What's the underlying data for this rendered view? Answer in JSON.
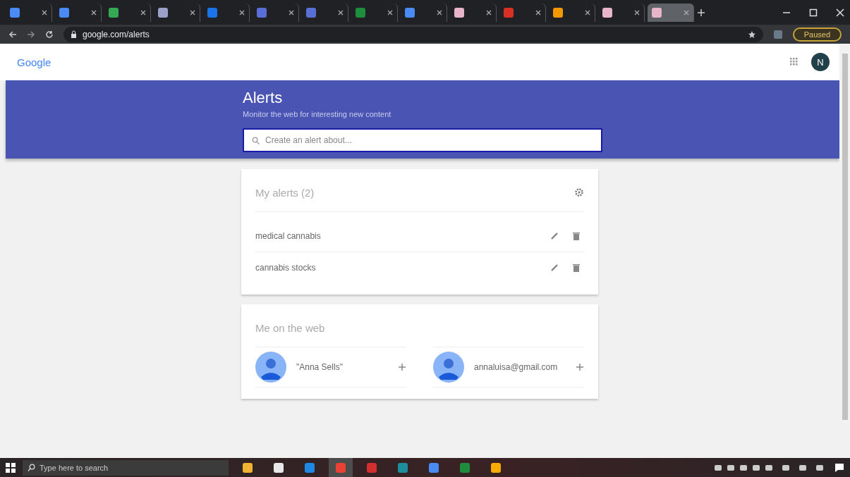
{
  "browser": {
    "tabs": [
      {
        "color": "#4a8af4",
        "selected": false
      },
      {
        "color": "#4a8af4",
        "selected": false
      },
      {
        "color": "#34a853",
        "selected": false
      },
      {
        "color": "#9aa0c8",
        "selected": false
      },
      {
        "color": "#1a73e8",
        "selected": false
      },
      {
        "color": "#5a6fd6",
        "selected": false
      },
      {
        "color": "#5a6fd6",
        "selected": false
      },
      {
        "color": "#1e8e3e",
        "selected": false
      },
      {
        "color": "#4a8af4",
        "selected": false
      },
      {
        "color": "#e8b4c8",
        "selected": false
      },
      {
        "color": "#d93025",
        "selected": false
      },
      {
        "color": "#f29900",
        "selected": false
      },
      {
        "color": "#e8b4c8",
        "selected": false
      },
      {
        "color": "#e8b4c8",
        "selected": true
      }
    ],
    "url": "google.com/alerts",
    "profile_status": "Paused"
  },
  "header": {
    "logo": "Google",
    "avatar": "N"
  },
  "banner": {
    "title": "Alerts",
    "subtitle": "Monitor the web for interesting new content",
    "search": {
      "placeholder": "Create an alert about..."
    }
  },
  "my_alerts": {
    "title": "My alerts (2)",
    "items": [
      "medical cannabis",
      "cannabis stocks"
    ]
  },
  "me_on_the_web": {
    "title": "Me on the web",
    "items": [
      "\"Anna Sells\"",
      "annaluisa@gmail.com"
    ]
  },
  "taskbar": {
    "search": {
      "placeholder": "Type here to search"
    },
    "apps": [
      {
        "color": "#f2b233",
        "selected": false
      },
      {
        "color": "#e8e8e8",
        "selected": false
      },
      {
        "color": "#1e88e5",
        "selected": false
      },
      {
        "color": "#e94235",
        "selected": true
      },
      {
        "color": "#d32f2f",
        "selected": false
      },
      {
        "color": "#1e8e9e",
        "selected": false
      },
      {
        "color": "#4a8af4",
        "selected": false
      },
      {
        "color": "#1e8e3e",
        "selected": false
      },
      {
        "color": "#f9ab00",
        "selected": false
      }
    ]
  }
}
